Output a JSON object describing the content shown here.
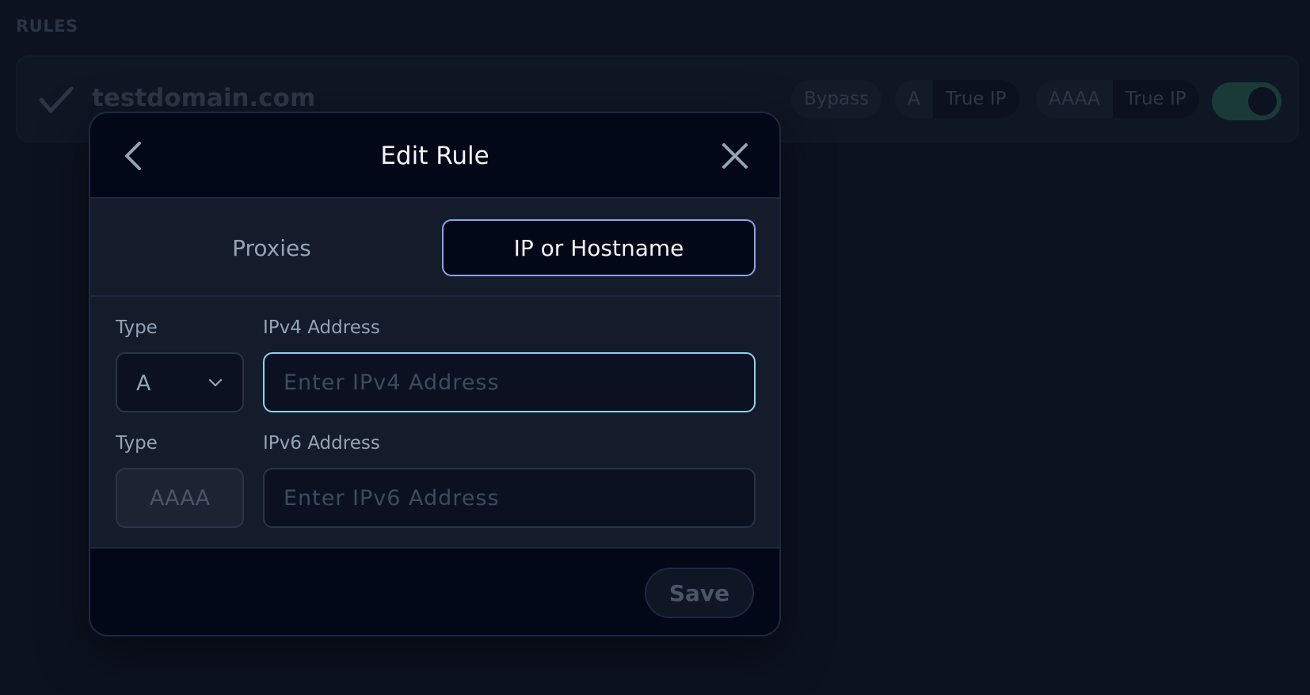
{
  "page": {
    "section_title": "RULES"
  },
  "rule": {
    "domain": "testdomain.com",
    "action_badge": "Bypass",
    "a_record": {
      "type": "A",
      "value": "True IP"
    },
    "aaaa_record": {
      "type": "AAAA",
      "value": "True IP"
    },
    "enabled": true
  },
  "modal": {
    "title": "Edit Rule",
    "tabs": [
      {
        "label": "Proxies",
        "active": false
      },
      {
        "label": "IP or Hostname",
        "active": true
      }
    ],
    "ipv4": {
      "type_label": "Type",
      "type_value": "A",
      "address_label": "IPv4 Address",
      "placeholder": "Enter IPv4 Address",
      "value": ""
    },
    "ipv6": {
      "type_label": "Type",
      "type_value": "AAAA",
      "address_label": "IPv6 Address",
      "placeholder": "Enter IPv6 Address",
      "value": ""
    },
    "save_label": "Save"
  },
  "colors": {
    "background": "#0c1220",
    "modal_surface": "#141b2a",
    "header_footer": "#020817",
    "active_tab_border": "#8ba3e6",
    "focused_input_border": "#8fd0f0",
    "toggle_on": "#1a3a38"
  },
  "icons": {
    "check": "check-icon",
    "back": "chevron-left-icon",
    "close": "close-icon",
    "dropdown": "chevron-down-icon"
  }
}
